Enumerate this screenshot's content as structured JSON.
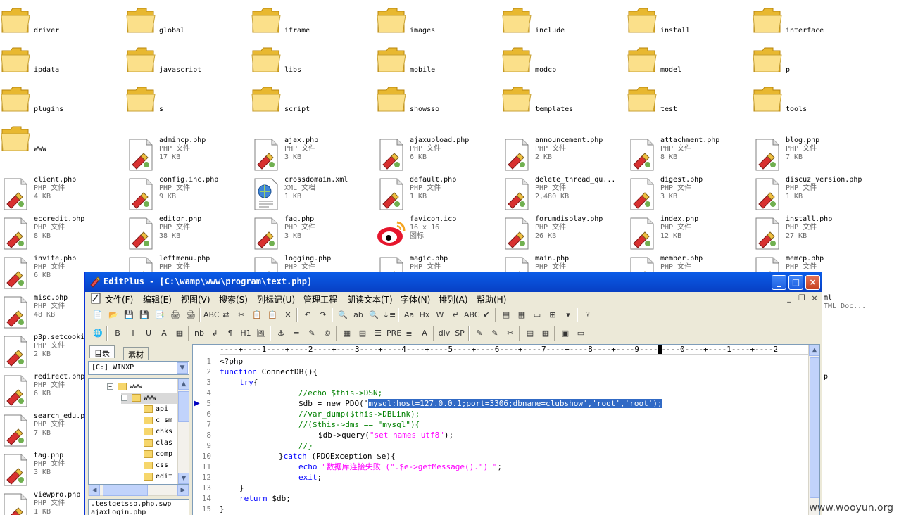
{
  "explorer": {
    "rows": [
      [
        {
          "name": "driver",
          "type": "folder"
        },
        {
          "name": "global",
          "type": "folder"
        },
        {
          "name": "iframe",
          "type": "folder"
        },
        {
          "name": "images",
          "type": "folder"
        },
        {
          "name": "include",
          "type": "folder"
        },
        {
          "name": "install",
          "type": "folder"
        },
        {
          "name": "interface",
          "type": "folder"
        }
      ],
      [
        {
          "name": "ipdata",
          "type": "folder"
        },
        {
          "name": "javascript",
          "type": "folder"
        },
        {
          "name": "libs",
          "type": "folder"
        },
        {
          "name": "mobile",
          "type": "folder"
        },
        {
          "name": "modcp",
          "type": "folder"
        },
        {
          "name": "model",
          "type": "folder"
        },
        {
          "name": "p",
          "type": "folder"
        }
      ],
      [
        {
          "name": "plugins",
          "type": "folder"
        },
        {
          "name": "s",
          "type": "folder"
        },
        {
          "name": "script",
          "type": "folder"
        },
        {
          "name": "showsso",
          "type": "folder"
        },
        {
          "name": "templates",
          "type": "folder"
        },
        {
          "name": "test",
          "type": "folder"
        },
        {
          "name": "tools",
          "type": "folder"
        }
      ],
      [
        {
          "name": "www",
          "type": "folder"
        },
        {
          "name": "admincp.php",
          "type": "php",
          "kind": "PHP 文件",
          "size": "17 KB"
        },
        {
          "name": "ajax.php",
          "type": "php",
          "kind": "PHP 文件",
          "size": "3 KB"
        },
        {
          "name": "ajaxupload.php",
          "type": "php",
          "kind": "PHP 文件",
          "size": "6 KB"
        },
        {
          "name": "announcement.php",
          "type": "php",
          "kind": "PHP 文件",
          "size": "2 KB"
        },
        {
          "name": "attachment.php",
          "type": "php",
          "kind": "PHP 文件",
          "size": "8 KB"
        },
        {
          "name": "blog.php",
          "type": "php",
          "kind": "PHP 文件",
          "size": "7 KB"
        }
      ],
      [
        {
          "name": "client.php",
          "type": "php",
          "kind": "PHP 文件",
          "size": "4 KB"
        },
        {
          "name": "config.inc.php",
          "type": "php",
          "kind": "PHP 文件",
          "size": "9 KB"
        },
        {
          "name": "crossdomain.xml",
          "type": "xml",
          "kind": "XML 文档",
          "size": "1 KB"
        },
        {
          "name": "default.php",
          "type": "php",
          "kind": "PHP 文件",
          "size": "1 KB"
        },
        {
          "name": "delete_thread_qu...",
          "type": "php",
          "kind": "PHP 文件",
          "size": "2,480 KB"
        },
        {
          "name": "digest.php",
          "type": "php",
          "kind": "PHP 文件",
          "size": "3 KB"
        },
        {
          "name": "discuz_version.php",
          "type": "php",
          "kind": "PHP 文件",
          "size": "1 KB"
        }
      ],
      [
        {
          "name": "eccredit.php",
          "type": "php",
          "kind": "PHP 文件",
          "size": "8 KB"
        },
        {
          "name": "editor.php",
          "type": "php",
          "kind": "PHP 文件",
          "size": "38 KB"
        },
        {
          "name": "faq.php",
          "type": "php",
          "kind": "PHP 文件",
          "size": "3 KB"
        },
        {
          "name": "favicon.ico",
          "type": "ico",
          "kind": "16 x 16",
          "size": "图标"
        },
        {
          "name": "forumdisplay.php",
          "type": "php",
          "kind": "PHP 文件",
          "size": "26 KB"
        },
        {
          "name": "index.php",
          "type": "php",
          "kind": "PHP 文件",
          "size": "12 KB"
        },
        {
          "name": "install.php",
          "type": "php",
          "kind": "PHP 文件",
          "size": "27 KB"
        }
      ],
      [
        {
          "name": "invite.php",
          "type": "php",
          "kind": "PHP 文件",
          "size": "6 KB"
        },
        {
          "name": "leftmenu.php",
          "type": "php",
          "kind": "PHP 文件",
          "size": ""
        },
        {
          "name": "logging.php",
          "type": "php",
          "kind": "PHP 文件",
          "size": ""
        },
        {
          "name": "magic.php",
          "type": "php",
          "kind": "PHP 文件",
          "size": ""
        },
        {
          "name": "main.php",
          "type": "php",
          "kind": "PHP 文件",
          "size": ""
        },
        {
          "name": "member.php",
          "type": "php",
          "kind": "PHP 文件",
          "size": ""
        },
        {
          "name": "memcp.php",
          "type": "php",
          "kind": "PHP 文件",
          "size": ""
        }
      ]
    ],
    "left_column": [
      {
        "name": "misc.php",
        "kind": "PHP 文件",
        "size": "48 KB"
      },
      {
        "name": "p3p.setcooki",
        "kind": "PHP 文件",
        "size": "2 KB"
      },
      {
        "name": "redirect.php",
        "kind": "PHP 文件",
        "size": "6 KB"
      },
      {
        "name": "search_edu.p",
        "kind": "PHP 文件",
        "size": "7 KB"
      },
      {
        "name": "tag.php",
        "kind": "PHP 文件",
        "size": "3 KB"
      },
      {
        "name": "viewpro.php",
        "kind": "PHP 文件",
        "size": "1 KB"
      }
    ],
    "right_peek": [
      {
        "name": "ml",
        "kind": "TML Doc..."
      },
      {
        "name": "p",
        "kind": ""
      }
    ]
  },
  "editplus": {
    "title": "EditPlus - [C:\\wamp\\www\\program\\text.php]",
    "window_buttons": {
      "minimize": "_",
      "maximize": "□",
      "close": "×"
    },
    "menu": [
      "文件(F)",
      "编辑(E)",
      "视图(V)",
      "搜索(S)",
      "列标记(U)",
      "管理工程",
      "朗读文本(T)",
      "字体(N)",
      "排列(A)",
      "帮助(H)"
    ],
    "mdi_buttons": [
      "_",
      "❐",
      "×"
    ],
    "toolbar1": [
      "📄",
      "📂",
      "💾",
      "💾",
      "📑",
      "🖨",
      "🖨",
      "ABC",
      "⇄",
      "✂",
      "📋",
      "📋",
      "✕",
      "↶",
      "↷",
      "🔍",
      "ab",
      "🔍",
      "↓≡",
      "Aa",
      "Hx",
      "W",
      "↵",
      "ABC",
      "✔",
      "▤",
      "▦",
      "▭",
      "⊞",
      "▾",
      "?"
    ],
    "toolbar2": [
      "🌐",
      "B",
      "I",
      "U",
      "A",
      "▦",
      "nb",
      "↲",
      "¶",
      "H1",
      "🖼",
      "⚓",
      "═",
      "✎",
      "©",
      "▦",
      "▤",
      "☰",
      "PRE",
      "≣",
      "A",
      "div",
      "SP",
      "✎",
      "✎",
      "✂",
      "▤",
      "▦",
      "▣",
      "▭"
    ],
    "tabs": {
      "directory": "目录",
      "material": "素材"
    },
    "drive": "[C:] WINXP",
    "tree": [
      {
        "label": "www",
        "level": 1,
        "expander": "⊟"
      },
      {
        "label": "www",
        "level": 2,
        "expander": "⊟",
        "selected": true
      },
      {
        "label": "api",
        "level": 3
      },
      {
        "label": "c_sm",
        "level": 3
      },
      {
        "label": "chks",
        "level": 3
      },
      {
        "label": "clas",
        "level": 3
      },
      {
        "label": "comp",
        "level": 3
      },
      {
        "label": "css",
        "level": 3
      },
      {
        "label": "edit",
        "level": 3
      }
    ],
    "files": [
      ".testgetsso.php.swp",
      "ajaxLogin.php"
    ],
    "ruler": "----+----1----+----2----+----3----+----4----+----5----+----6----+----7----+----8----+----9----",
    "ruler_tail": "----0----+----1----+----2",
    "line_numbers": [
      "1",
      "2",
      "3",
      "4",
      "5",
      "6",
      "7",
      "8",
      "9",
      "10",
      "11",
      "12",
      "13",
      "14",
      "15"
    ],
    "code": {
      "l1": "<?php",
      "l2_kw": "function",
      "l2_rest": " ConnectDB(){",
      "l3_kw": "try",
      "l3_rest": "{",
      "l4": "//echo $this->DSN;",
      "l5_pre": "$db = new PDO('",
      "l5_sel": "mysql:host=127.0.0.1;port=3306;dbname=clubshow','root','root');",
      "l6": "//var_dump($this->DBLink);",
      "l7": "//($this->dms == \"mysql\"){",
      "l8_pre": "$db->query(",
      "l8_str": "\"set names utf8\"",
      "l8_post": ");",
      "l9": "//}",
      "l10_pre": "}",
      "l10_kw": "catch",
      "l10_rest": " (PDOException $e){",
      "l11_kw": "echo",
      "l11_str": " \"数据库连接失败 (\".$e->getMessage().\") \"",
      "l11_post": ";",
      "l12_kw": "exit",
      "l12_rest": ";",
      "l13": "}",
      "l14_kw": "return",
      "l14_rest": " $db;",
      "l15": "}"
    }
  },
  "watermark": "www.wooyun.org"
}
